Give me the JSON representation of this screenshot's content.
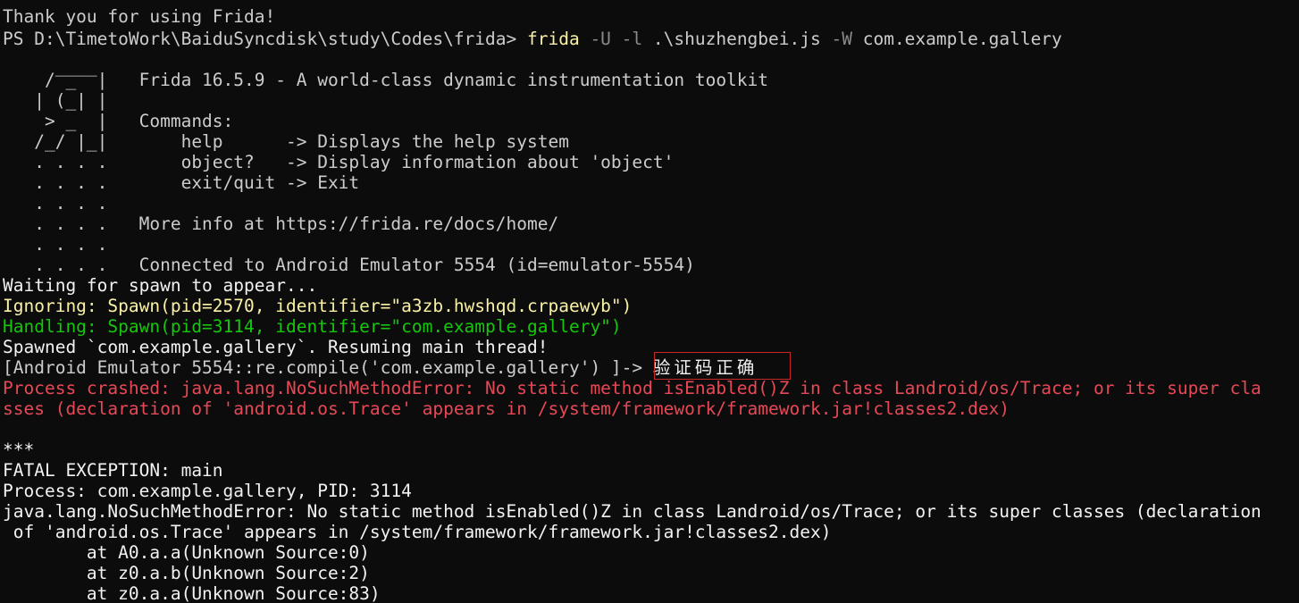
{
  "terminal": {
    "thank_you": "Thank you for using Frida!",
    "prompt_path": "PS D:\\TimetoWork\\BaiduSyncdisk\\study\\Codes\\frida> ",
    "cmd_name": "frida",
    "cmd_flag_u": " -U -l",
    "cmd_script": " .\\shuzhengbei.js",
    "cmd_flag_w": " -W",
    "cmd_target": " com.example.gallery",
    "banner": [
      "     ____",
      "    / _  |   Frida 16.5.9 - A world-class dynamic instrumentation toolkit",
      "   | (_| |",
      "    > _  |   Commands:",
      "   /_/ |_|       help      -> Displays the help system",
      "   . . . .       object?   -> Display information about 'object'",
      "   . . . .       exit/quit -> Exit",
      "   . . . .",
      "   . . . .   More info at https://frida.re/docs/home/",
      "   . . . .",
      "   . . . .   Connected to Android Emulator 5554 (id=emulator-5554)"
    ],
    "waiting": "Waiting for spawn to appear...",
    "ignoring": "Ignoring: Spawn(pid=2570, identifier=\"a3zb.hwshqd.crpaewyb\")",
    "handling": "Handling: Spawn(pid=3114, identifier=\"com.example.gallery\")",
    "spawned": "Spawned `com.example.gallery`. Resuming main thread!",
    "repl_prompt": "[Android Emulator 5554::re.compile('com.example.gallery') ]-> ",
    "repl_output": "验证码正确",
    "crash_line1": "Process crashed: java.lang.NoSuchMethodError: No static method isEnabled()Z in class Landroid/os/Trace; or its super cla",
    "crash_line2": "sses (declaration of 'android.os.Trace' appears in /system/framework/framework.jar!classes2.dex)",
    "stars": "***",
    "fatal": "FATAL EXCEPTION: main",
    "process": "Process: com.example.gallery, PID: 3114",
    "error_line1": "java.lang.NoSuchMethodError: No static method isEnabled()Z in class Landroid/os/Trace; or its super classes (declaration",
    "error_line2": " of 'android.os.Trace' appears in /system/framework/framework.jar!classes2.dex)",
    "stack": [
      "        at A0.a.a(Unknown Source:0)",
      "        at z0.a.b(Unknown Source:2)",
      "        at z0.a.a(Unknown Source:83)"
    ]
  },
  "colors": {
    "background": "#0c0c0c",
    "text": "#cccccc",
    "bright": "#f2f2f2",
    "yellow": "#f9f1a5",
    "green": "#16c60c",
    "red": "#e74856",
    "highlight_box": "#c62828"
  }
}
